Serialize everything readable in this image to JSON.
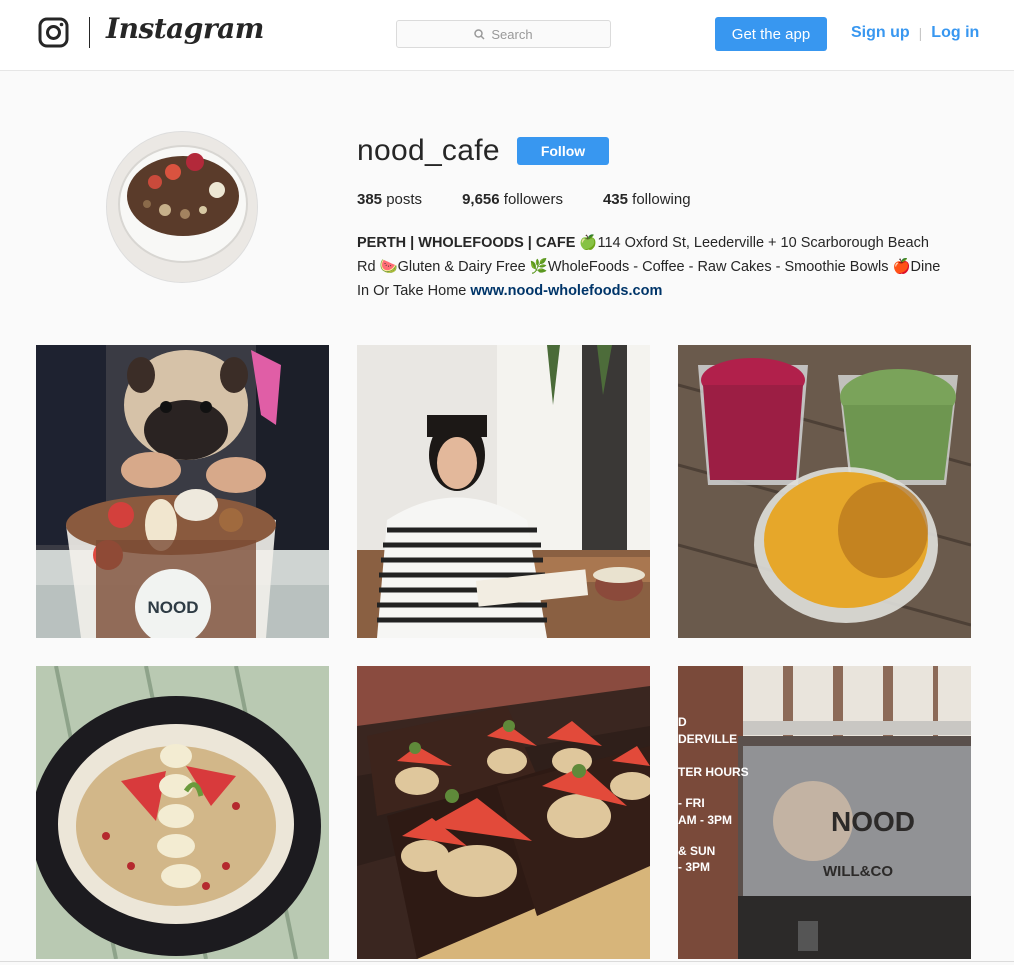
{
  "header": {
    "brand": "Instagram",
    "search_placeholder": "Search",
    "get_app_label": "Get the app",
    "signup_label": "Sign up",
    "login_label": "Log in"
  },
  "profile": {
    "username": "nood_cafe",
    "follow_label": "Follow",
    "posts_count": "385",
    "posts_label": "posts",
    "followers_count": "9,656",
    "followers_label": "followers",
    "following_count": "435",
    "following_label": "following",
    "bio_name": "PERTH | WHOLEFOODS | CAFE",
    "bio_line1": "🍏114 Oxford St, Leederville + 10 Scarborough Beach",
    "bio_line2": "Rd 🍉Gluten & Dairy Free 🌿WholeFoods - Coffee - Raw Cakes - Smoothie Bowls 🍎Dine",
    "bio_line3": "In Or Take Home ",
    "bio_link": "www.nood-wholefoods.com"
  },
  "posts": [
    {
      "id": "post-1",
      "icon": "pug-smoothie-bowl-photo",
      "cup_text": "NOOD"
    },
    {
      "id": "post-2",
      "icon": "woman-striped-sweater-photo"
    },
    {
      "id": "post-3",
      "icon": "colorful-lattes-photo"
    },
    {
      "id": "post-4",
      "icon": "porridge-bowl-photo"
    },
    {
      "id": "post-5",
      "icon": "raw-cakes-strawberries-photo"
    },
    {
      "id": "post-6",
      "icon": "coffee-machine-photo",
      "sign_lines": [
        "D",
        "DERVILLE",
        "TER HOURS",
        "- FRI",
        "AM - 3PM",
        "& SUN",
        "- 3PM"
      ],
      "machine_text": "NOOD",
      "machine_sub": "WILL&CO"
    }
  ],
  "colors": {
    "accent": "#3897f0",
    "link": "#003569",
    "text": "#262626"
  }
}
